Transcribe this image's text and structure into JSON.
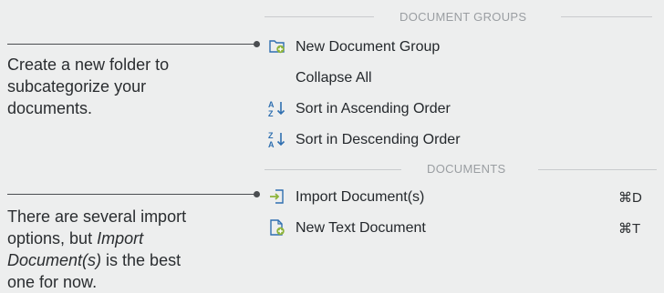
{
  "annotations": {
    "create_folder": "Create a new folder to subcategorize your documents.",
    "import_line1": "There are several import",
    "import_line2_pre": "options, but ",
    "import_line2_em": "Import",
    "import_line3_em": "Document(s)",
    "import_line3_post": " is the best",
    "import_line4": "one for now."
  },
  "menu": {
    "document_groups_header": "DOCUMENT GROUPS",
    "documents_header": "DOCUMENTS",
    "new_document_group": "New Document Group",
    "collapse_all": "Collapse All",
    "sort_ascending": "Sort in Ascending Order",
    "sort_descending": "Sort in Descending Order",
    "import_documents": "Import Document(s)",
    "import_shortcut": "⌘D",
    "new_text_document": "New Text Document",
    "new_text_shortcut": "⌘T"
  },
  "icons": {
    "new_group": "folder-add-icon",
    "sort_ascending": "sort-ascending-icon",
    "sort_descending": "sort-descending-icon",
    "import": "import-icon",
    "new_text": "document-add-icon"
  },
  "colors": {
    "icon_blue": "#2f6fb0",
    "icon_green": "#8db33a"
  }
}
